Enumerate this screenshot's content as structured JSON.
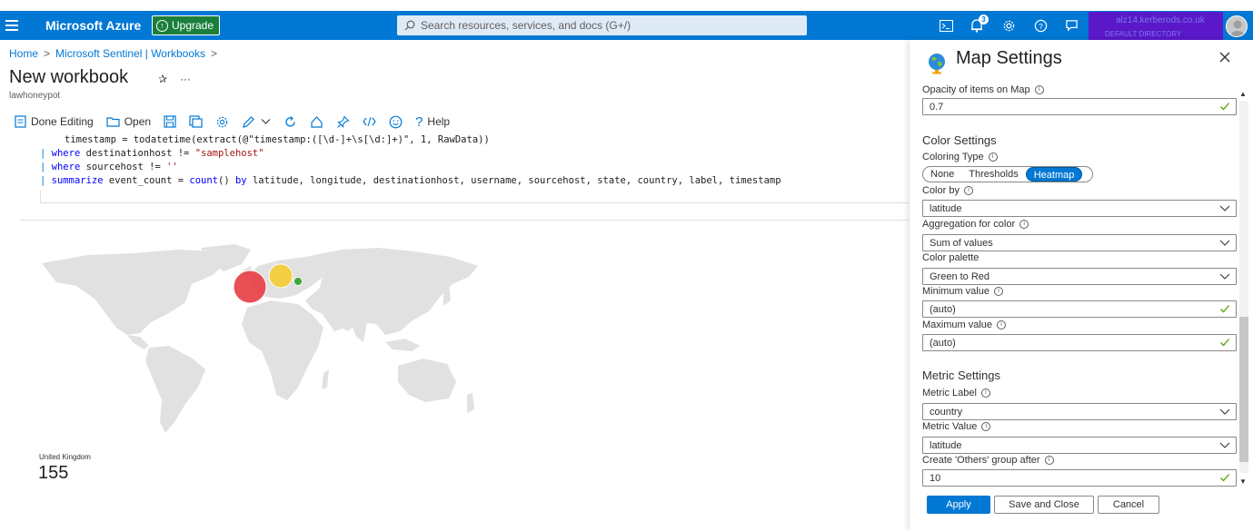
{
  "topbar": {
    "brand": "Microsoft Azure",
    "upgrade_label": "Upgrade",
    "search_placeholder": "Search resources, services, and docs (G+/)",
    "notification_count": "3",
    "account_line1": "alz14.kerberods.co.uk",
    "account_line2": "DEFAULT DIRECTORY"
  },
  "breadcrumb": [
    "Home",
    "Microsoft Sentinel | Workbooks"
  ],
  "page": {
    "title": "New workbook",
    "subtitle": "lawhoneypot"
  },
  "toolbar": {
    "done_editing": "Done Editing",
    "open": "Open",
    "help": "Help"
  },
  "query": {
    "line1": "timestamp = todatetime(extract(@\"timestamp:([\\d-]+\\s[\\d:]+)\", 1, RawData))",
    "line2_kw": "where",
    "line2_rest": " destinationhost != ",
    "line2_str": "\"samplehost\"",
    "line3_kw": "where",
    "line3_rest": " sourcehost != ",
    "line3_str": "''",
    "line4_kw": "summarize",
    "line4_a": " event_count = ",
    "line4_fn": "count",
    "line4_b": "() ",
    "line4_by": "by",
    "line4_c": " latitude, longitude, destinationhost, username, sourcehost, state, country, label, timestamp"
  },
  "map": {
    "legend_label": "United Kingdom",
    "legend_value": "155",
    "colors": {
      "land": "#e1e1e1",
      "red": "#e8474c",
      "yellow": "#f5cf3d",
      "green": "#3fa83f"
    }
  },
  "panel": {
    "title": "Map Settings",
    "opacity_label": "Opacity of items on Map",
    "opacity_value": "0.7",
    "color_settings": "Color Settings",
    "coloring_type_label": "Coloring Type",
    "coloring_options": [
      "None",
      "Thresholds",
      "Heatmap"
    ],
    "color_by_label": "Color by",
    "color_by_value": "latitude",
    "aggregation_label": "Aggregation for color",
    "aggregation_value": "Sum of values",
    "palette_label": "Color palette",
    "palette_value": "Green to Red",
    "min_label": "Minimum value",
    "min_value": "(auto)",
    "max_label": "Maximum value",
    "max_value": "(auto)",
    "metric_settings": "Metric Settings",
    "metric_label_label": "Metric Label",
    "metric_label_value": "country",
    "metric_value_label": "Metric Value",
    "metric_value_value": "latitude",
    "others_label": "Create 'Others' group after",
    "others_value": "10",
    "apply": "Apply",
    "save_close": "Save and Close",
    "cancel": "Cancel"
  }
}
